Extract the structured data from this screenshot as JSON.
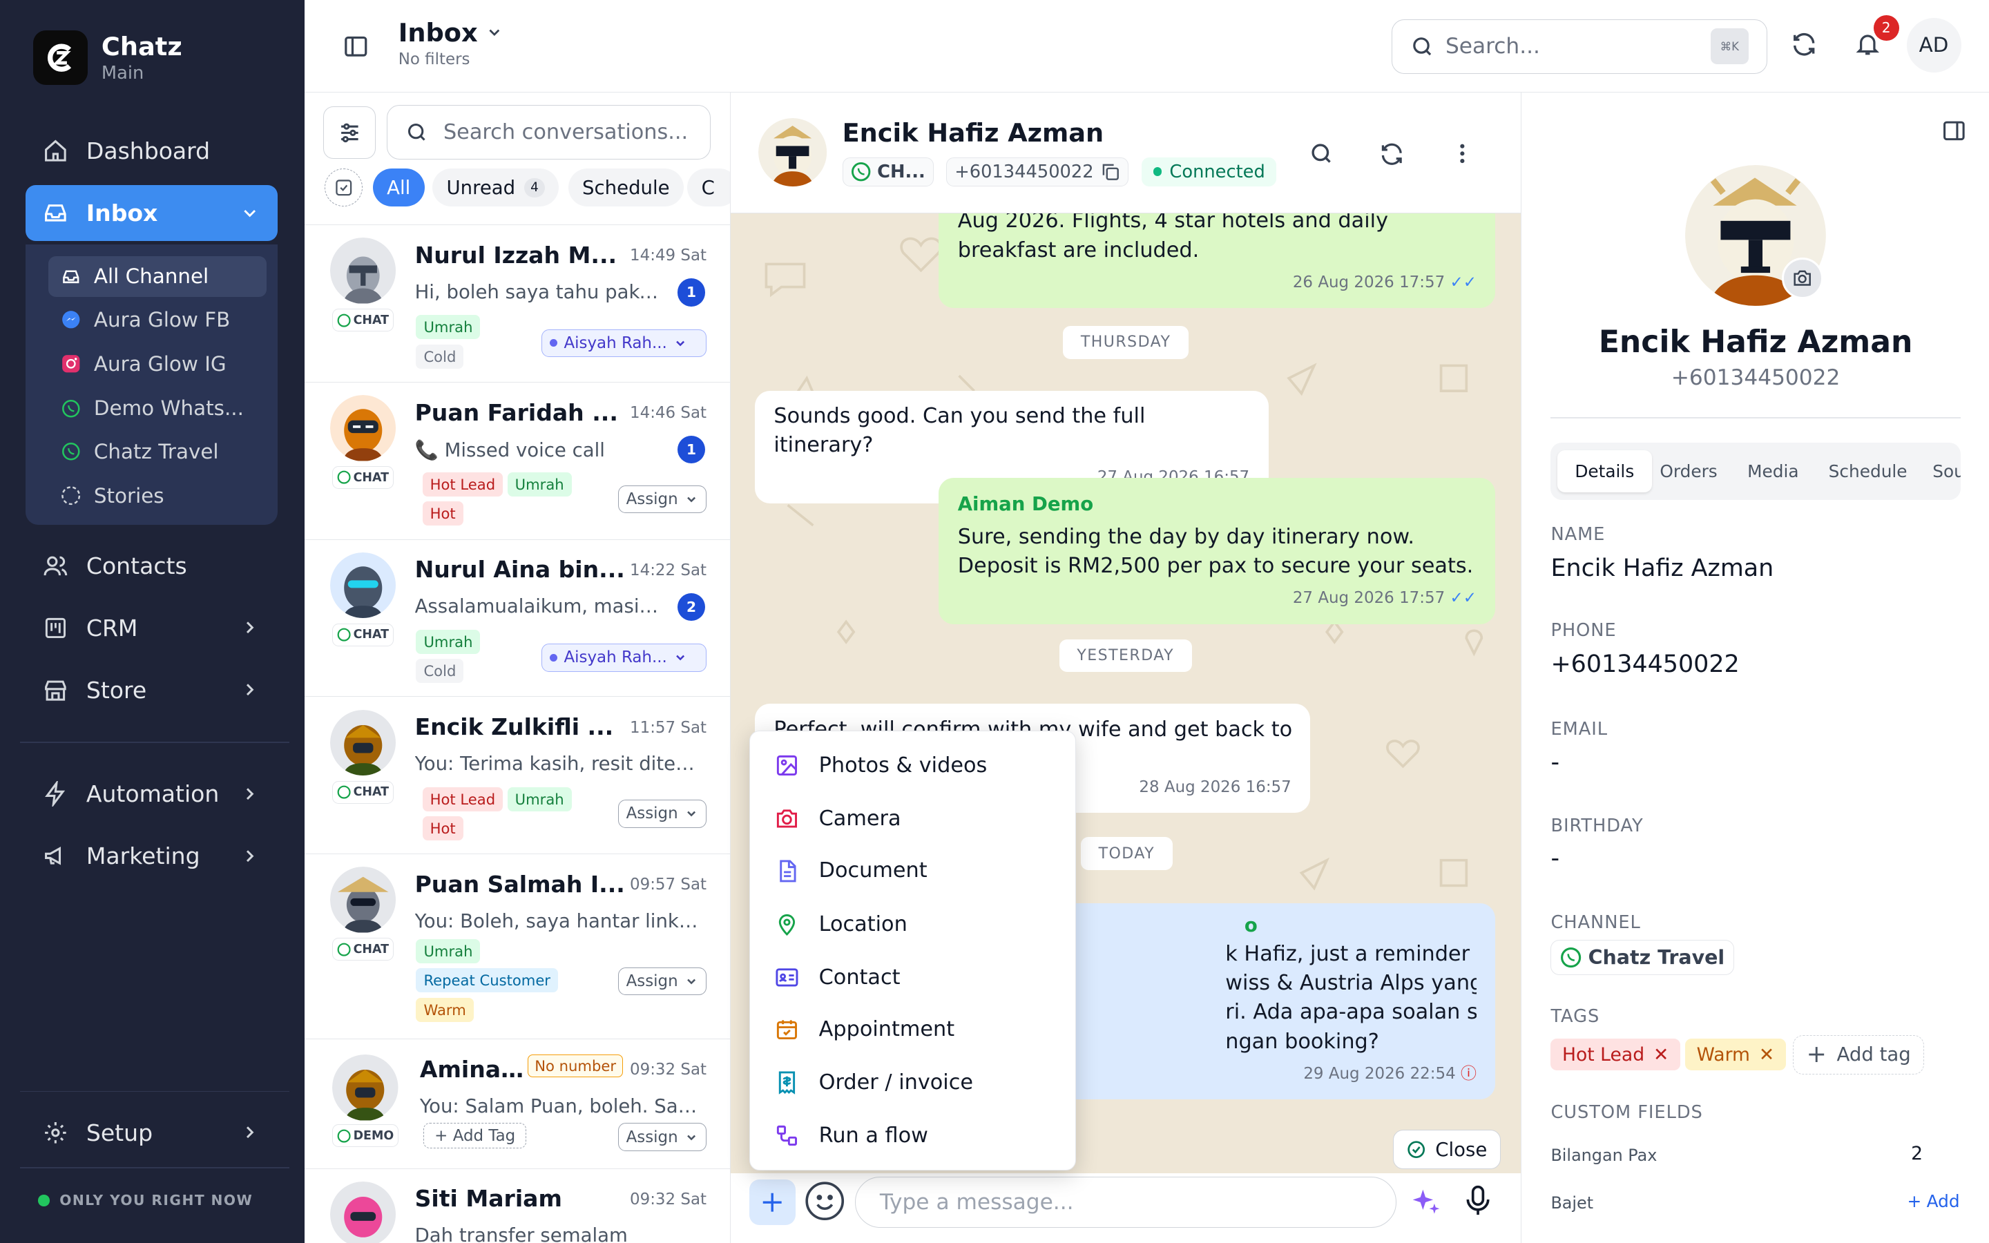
{
  "brand": {
    "name": "Chatz",
    "sub": "Main"
  },
  "nav": {
    "dashboard": "Dashboard",
    "inbox": "Inbox",
    "contacts": "Contacts",
    "crm": "CRM",
    "store": "Store",
    "automation": "Automation",
    "marketing": "Marketing",
    "setup": "Setup"
  },
  "channels": [
    {
      "label": "All Channel",
      "icon": "inbox-icon"
    },
    {
      "label": "Aura Glow FB",
      "icon": "messenger-icon"
    },
    {
      "label": "Aura Glow IG",
      "icon": "instagram-icon"
    },
    {
      "label": "Demo Whats...",
      "icon": "whatsapp-icon"
    },
    {
      "label": "Chatz Travel",
      "icon": "whatsapp-icon"
    },
    {
      "label": "Stories",
      "icon": "stories-icon"
    }
  ],
  "status": "ONLY YOU RIGHT NOW",
  "header": {
    "title": "Inbox",
    "subtitle": "No filters",
    "search_placeholder": "Search...",
    "shortcut": "⌘K",
    "notif_count": "2",
    "user_initials": "AD"
  },
  "list": {
    "search_placeholder": "Search conversations...",
    "filters": [
      {
        "label": "All",
        "active": true
      },
      {
        "label": "Unread",
        "count": "4"
      },
      {
        "label": "Schedule"
      },
      {
        "label": "C"
      }
    ],
    "assign_label": "Assign",
    "add_tag_label": "Add Tag",
    "no_number_label": "No number",
    "conversations": [
      {
        "name": "Nurul Izzah M...",
        "time": "14:49 Sat",
        "preview": "Hi, boleh saya tahu pakej...",
        "unread": "1",
        "channel": "CHAT",
        "tags": [
          "Umrah",
          "Cold"
        ],
        "agent": "Aisyah Rah..."
      },
      {
        "name": "Puan Faridah ...",
        "time": "14:46 Sat",
        "preview": "📞 Missed voice call",
        "unread": "1",
        "channel": "CHAT",
        "tags": [
          "Hot Lead",
          "Umrah",
          "Hot"
        ]
      },
      {
        "name": "Nurul Aina bin...",
        "time": "14:22 Sat",
        "preview": "Assalamualaikum, masih ...",
        "unread": "2",
        "channel": "CHAT",
        "tags": [
          "Umrah",
          "Cold"
        ],
        "agent": "Aisyah Rah..."
      },
      {
        "name": "Encik Zulkifli ...",
        "time": "11:57 Sat",
        "preview": "You: Terima kasih, resit diteri...",
        "channel": "CHAT",
        "tags": [
          "Hot Lead",
          "Umrah",
          "Hot"
        ]
      },
      {
        "name": "Puan Salmah I...",
        "time": "09:57 Sat",
        "preview": "You: Boleh, saya hantar link ...",
        "channel": "CHAT",
        "tags": [
          "Umrah",
          "Repeat Customer",
          "Warm"
        ]
      },
      {
        "name": "Amina...",
        "time": "09:32 Sat",
        "preview": "You: Salam Puan, boleh. Say...",
        "channel": "DEMO"
      },
      {
        "name": "Siti Mariam",
        "time": "09:32 Sat",
        "preview": "Dah transfer semalam"
      }
    ]
  },
  "chat": {
    "contact_name": "Encik Hafiz Azman",
    "channel_short": "CH...",
    "phone": "+60134450022",
    "status": "Connected",
    "messages": [
      {
        "dir": "out",
        "text": "Aug 2026. Flights, 4 star hotels and daily breakfast are included.",
        "time": "26 Aug 2026 17:57"
      },
      {
        "divider": "THURSDAY"
      },
      {
        "dir": "in",
        "text": "Sounds good. Can you send the full itinerary?",
        "time": "27 Aug 2026 16:57"
      },
      {
        "dir": "out",
        "sender": "Aiman Demo",
        "text": "Sure, sending the day by day itinerary now. Deposit is RM2,500 per pax to secure your seats.",
        "time": "27 Aug 2026 17:57"
      },
      {
        "divider": "YESTERDAY"
      },
      {
        "dir": "in",
        "text": "Perfect, will confirm with my wife and get back to",
        "time": "28 Aug 2026 16:57"
      },
      {
        "divider": "TODAY"
      },
      {
        "dir": "out",
        "sender": "o",
        "lines": [
          "k Hafiz, just a reminder untuk",
          "wiss & Austria Alps yang saya hantar",
          "ri. Ada apa-apa soalan sebelum kita",
          "ngan booking?"
        ],
        "time": "29 Aug 2026 22:54"
      }
    ],
    "close_label": "Close",
    "input_placeholder": "Type a message..."
  },
  "attach_menu": [
    {
      "label": "Photos & videos",
      "icon": "image-icon",
      "color": "#7c3aed"
    },
    {
      "label": "Camera",
      "icon": "camera-icon",
      "color": "#e11d48"
    },
    {
      "label": "Document",
      "icon": "document-icon",
      "color": "#6366f1"
    },
    {
      "label": "Location",
      "icon": "location-icon",
      "color": "#16a34a"
    },
    {
      "label": "Contact",
      "icon": "contact-card-icon",
      "color": "#4f46e5"
    },
    {
      "label": "Appointment",
      "icon": "calendar-icon",
      "color": "#d97706"
    },
    {
      "label": "Order / invoice",
      "icon": "invoice-icon",
      "color": "#0891b2"
    },
    {
      "label": "Run a flow",
      "icon": "flow-icon",
      "color": "#7c3aed"
    }
  ],
  "profile": {
    "name": "Encik Hafiz Azman",
    "phone": "+60134450022",
    "tabs": [
      "Details",
      "Orders",
      "Media",
      "Schedule",
      "Sou"
    ],
    "fields": [
      {
        "label": "NAME",
        "value": "Encik Hafiz Azman"
      },
      {
        "label": "PHONE",
        "value": "+60134450022"
      },
      {
        "label": "EMAIL",
        "value": "-"
      },
      {
        "label": "BIRTHDAY",
        "value": "-"
      }
    ],
    "channel_label": "CHANNEL",
    "channel": "Chatz Travel",
    "tags_label": "TAGS",
    "tags": [
      "Hot Lead",
      "Warm"
    ],
    "add_tag": "Add tag",
    "custom_label": "CUSTOM FIELDS",
    "custom_fields": [
      {
        "label": "Bilangan Pax",
        "value": "2"
      },
      {
        "label": "Bajet",
        "action": "Add"
      }
    ]
  },
  "colors": {
    "sidebar": "#1e2337",
    "accent": "#3b82f6",
    "chat_bg": "#efe7d7",
    "out_bubble": "#dcf8c6",
    "connected": "#10b981"
  }
}
